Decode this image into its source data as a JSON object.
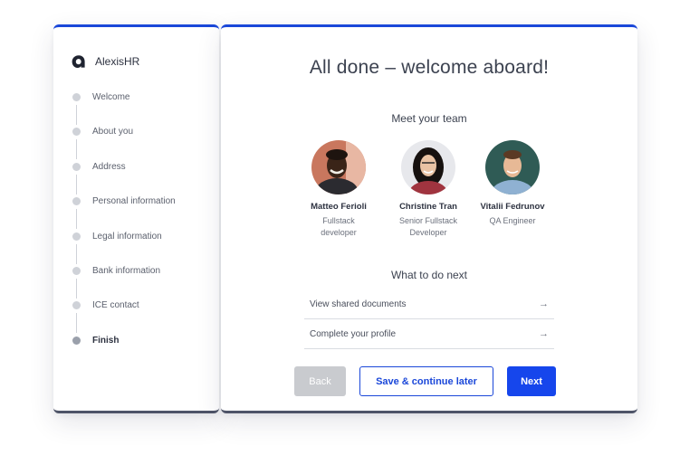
{
  "brand": {
    "name": "AlexisHR"
  },
  "steps": [
    {
      "label": "Welcome"
    },
    {
      "label": "About you"
    },
    {
      "label": "Address"
    },
    {
      "label": "Personal information"
    },
    {
      "label": "Legal information"
    },
    {
      "label": "Bank information"
    },
    {
      "label": "ICE contact"
    },
    {
      "label": "Finish",
      "current": true
    }
  ],
  "main": {
    "title": "All done – welcome aboard!",
    "team_heading": "Meet your team",
    "team": [
      {
        "name": "Matteo Ferioli",
        "role_line1": "Fullstack",
        "role_line2": "developer"
      },
      {
        "name": "Christine Tran",
        "role_line1": "Senior Fullstack",
        "role_line2": "Developer"
      },
      {
        "name": "Vitalii Fedrunov",
        "role_line1": "QA Engineer",
        "role_line2": ""
      }
    ],
    "next_heading": "What to do next",
    "todo": [
      {
        "label": "View shared documents",
        "arrow": "→"
      },
      {
        "label": "Complete your profile",
        "arrow": "→"
      }
    ],
    "buttons": {
      "back": "Back",
      "save": "Save & continue later",
      "next": "Next"
    }
  },
  "colors": {
    "accent": "#1a47d9",
    "primary_button": "#1646ec",
    "disabled_button": "#c9cbcf"
  }
}
